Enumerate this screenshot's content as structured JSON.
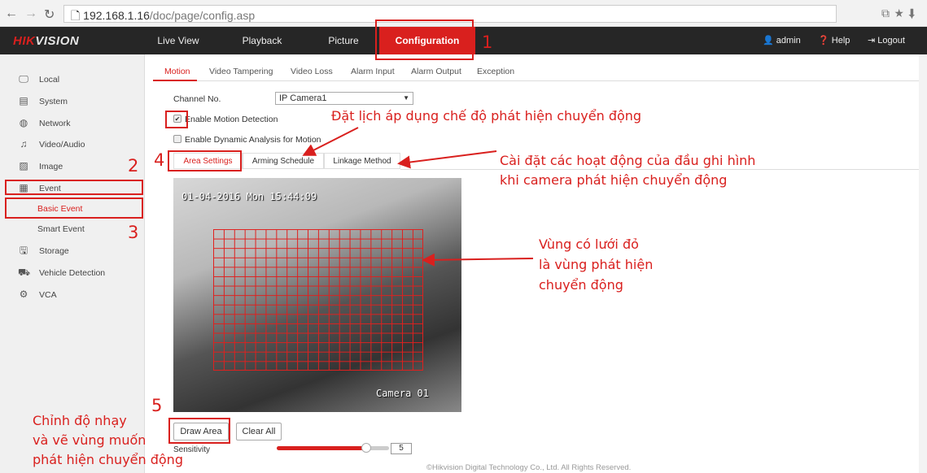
{
  "browser": {
    "url_host": "192.168.1.16",
    "url_path": "/doc/page/config.asp"
  },
  "topbar": {
    "logo": "HIKVISION",
    "logo_red": "HIK",
    "logo_rest": "VISION",
    "nav": [
      "Live View",
      "Playback",
      "Picture",
      "Configuration"
    ],
    "active": "Configuration",
    "user": "admin",
    "help": "Help",
    "logout": "Logout"
  },
  "sidebar": {
    "items": [
      {
        "label": "Local",
        "icon": "monitor-icon"
      },
      {
        "label": "System",
        "icon": "system-icon"
      },
      {
        "label": "Network",
        "icon": "globe-icon"
      },
      {
        "label": "Video/Audio",
        "icon": "video-audio-icon"
      },
      {
        "label": "Image",
        "icon": "image-icon"
      },
      {
        "label": "Event",
        "icon": "calendar-icon"
      },
      {
        "label": "Storage",
        "icon": "storage-icon"
      },
      {
        "label": "Vehicle Detection",
        "icon": "vehicle-icon"
      },
      {
        "label": "VCA",
        "icon": "vca-icon"
      }
    ],
    "subitems": [
      "Basic Event",
      "Smart Event"
    ],
    "active_sub": "Basic Event"
  },
  "tabs": [
    "Motion",
    "Video Tampering",
    "Video Loss",
    "Alarm Input",
    "Alarm Output",
    "Exception"
  ],
  "form": {
    "channel_label": "Channel No.",
    "channel_value": "IP Camera1",
    "enable_motion": "Enable Motion Detection",
    "enable_motion_checked": true,
    "enable_dynamic": "Enable Dynamic Analysis for Motion",
    "enable_dynamic_checked": false
  },
  "subtabs": [
    "Area Settings",
    "Arming Schedule",
    "Linkage Method"
  ],
  "video": {
    "timestamp": "01-04-2016 Mon 15:44:09",
    "camera": "Camera 01"
  },
  "buttons": {
    "draw_area": "Draw Area",
    "clear_all": "Clear All"
  },
  "sensitivity": {
    "label": "Sensitivity",
    "value": "5",
    "fill_fraction": 0.8
  },
  "footer": "©Hikvision Digital Technology Co., Ltd. All Rights Reserved.",
  "annotations": {
    "n1": "1",
    "n2": "2",
    "n3": "3",
    "n4": "4",
    "n5": "5",
    "schedule": "Đặt lịch áp dụng chế độ phát hiện chuyển động",
    "linkage1": "Cài đặt các hoạt động của đầu ghi hình",
    "linkage2": "khi camera phát hiện chuyển động",
    "grid1": "Vùng có lưới đỏ",
    "grid2": "là vùng phát hiện",
    "grid3": "chuyển động",
    "draw1": "Chỉnh độ nhạy",
    "draw2": "và vẽ vùng muốn",
    "draw3": "phát hiện chuyển động"
  },
  "colors": {
    "accent": "#d9201e",
    "topbar": "#262626"
  }
}
